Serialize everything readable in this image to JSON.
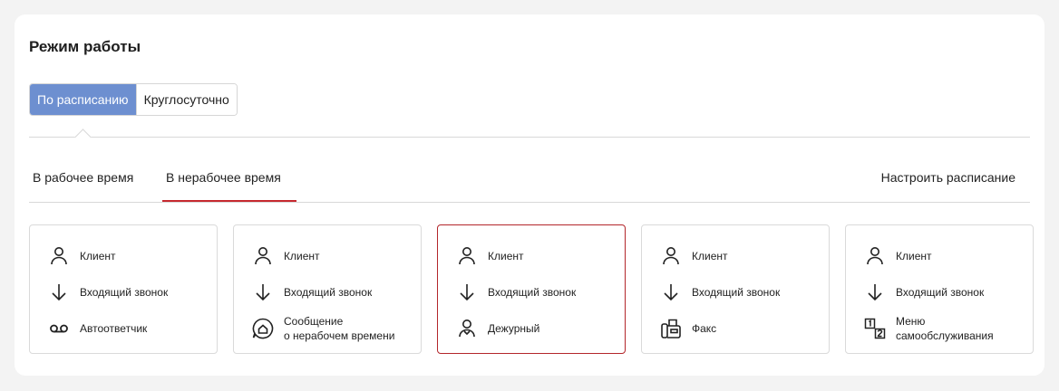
{
  "section": {
    "title": "Режим работы"
  },
  "mode": {
    "options": [
      "По расписанию",
      "Круглосуточно"
    ],
    "selected": 0
  },
  "tabs": {
    "working": "В рабочее время",
    "nonworking": "В нерабочее время",
    "configure": "Настроить расписание"
  },
  "cards": [
    {
      "client": "Клиент",
      "call": "Входящий звонок",
      "target": "Автоответчик",
      "target_icon": "voicemail-icon"
    },
    {
      "client": "Клиент",
      "call": "Входящий звонок",
      "target": "Сообщение\nо нерабочем времени",
      "target_line1": "Сообщение",
      "target_line2": "о нерабочем времени",
      "target_icon": "message-home-icon"
    },
    {
      "client": "Клиент",
      "call": "Входящий звонок",
      "target": "Дежурный",
      "target_icon": "duty-operator-icon",
      "selected": true
    },
    {
      "client": "Клиент",
      "call": "Входящий звонок",
      "target": "Факс",
      "target_icon": "fax-icon"
    },
    {
      "client": "Клиент",
      "call": "Входящий звонок",
      "target": "Меню\nсамообслуживания",
      "target_line1": "Меню",
      "target_line2": "самообслуживания",
      "target_icon": "self-service-menu-icon"
    }
  ],
  "colors": {
    "accent": "#6d8fd0",
    "selected_border": "#b3262b",
    "tab_underline": "#c6292f"
  }
}
